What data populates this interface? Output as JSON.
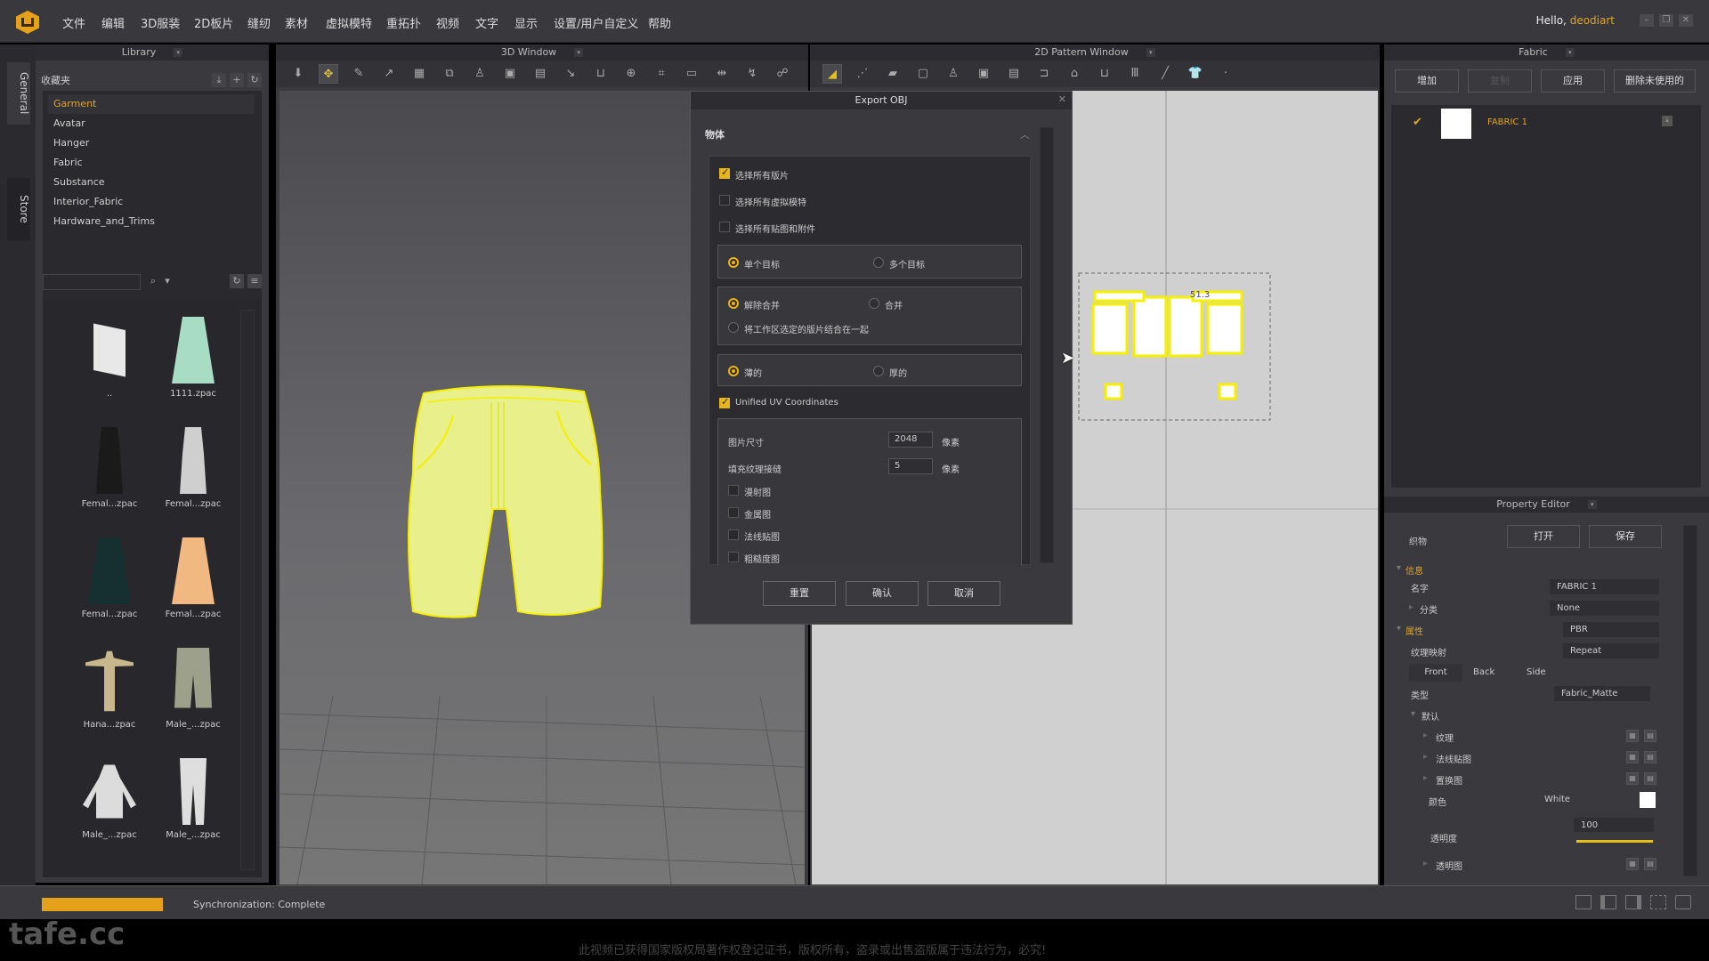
{
  "app": {
    "menu": [
      "文件",
      "编辑",
      "3D服装",
      "2D板片",
      "缝纫",
      "素材",
      "虚拟模特",
      "重拓扑",
      "视频",
      "文字",
      "显示",
      "设置/用户自定义",
      "帮助"
    ],
    "greeting": "Hello,",
    "username": "deodiart",
    "window_controls": {
      "minimize": "–",
      "restore": "❐",
      "close": "✕"
    }
  },
  "side_tabs": [
    "General",
    "Store"
  ],
  "library": {
    "title": "Library",
    "favorites_label": "收藏夹",
    "tree": [
      "Garment",
      "Avatar",
      "Hanger",
      "Fabric",
      "Substance",
      "Interior_Fabric",
      "Hardware_and_Trims"
    ],
    "selected": "Garment",
    "search_placeholder": "",
    "items": [
      {
        "label": "..",
        "color": "#e8e8e8",
        "shape": "folder"
      },
      {
        "label": "1111.zpac",
        "color": "#a8dcc4",
        "shape": "skirt"
      },
      {
        "label": "Femal...zpac",
        "color": "#1a1a1a",
        "shape": "dress"
      },
      {
        "label": "Femal...zpac",
        "color": "#cfcfcf",
        "shape": "dress"
      },
      {
        "label": "Femal...zpac",
        "color": "#163032",
        "shape": "skirt"
      },
      {
        "label": "Femal...zpac",
        "color": "#f2b882",
        "shape": "skirt"
      },
      {
        "label": "Hana...zpac",
        "color": "#c8b68c",
        "shape": "avatar"
      },
      {
        "label": "Male_...zpac",
        "color": "#9da08a",
        "shape": "shorts"
      },
      {
        "label": "Male_...zpac",
        "color": "#dcdcdc",
        "shape": "hoodie"
      },
      {
        "label": "Male_...zpac",
        "color": "#dedede",
        "shape": "pants"
      }
    ]
  },
  "window3d": {
    "title": "3D Window"
  },
  "window2d": {
    "title": "2D Pattern Window",
    "measurement": "51.3"
  },
  "dialog": {
    "title": "Export OBJ",
    "section": "物体",
    "select_all_patterns": {
      "label": "选择所有版片",
      "checked": true
    },
    "select_all_avatars": {
      "label": "选择所有虚拟模特",
      "checked": false
    },
    "select_all_trims": {
      "label": "选择所有贴图和附件",
      "checked": false
    },
    "object_mode": {
      "options": [
        "单个目标",
        "多个目标"
      ],
      "selected": "单个目标"
    },
    "merge_mode": {
      "options": [
        "解除合并",
        "合并",
        "将工作区选定的版片结合在一起"
      ],
      "selected": "解除合并"
    },
    "thickness": {
      "options": [
        "薄的",
        "厚的"
      ],
      "selected": "薄的"
    },
    "unified_uv": {
      "label": "Unified UV Coordinates",
      "checked": true
    },
    "image_size": {
      "label": "图片尺寸",
      "value": "2048",
      "unit": "像素"
    },
    "padding": {
      "label": "填充纹理接缝",
      "value": "5",
      "unit": "像素"
    },
    "maps": [
      {
        "label": "漫射图",
        "checked": false
      },
      {
        "label": "金属图",
        "checked": false
      },
      {
        "label": "法线贴图",
        "checked": false
      },
      {
        "label": "粗糙度图",
        "checked": false
      }
    ],
    "buttons": {
      "reset": "重置",
      "confirm": "确认",
      "cancel": "取消"
    }
  },
  "fabric_panel": {
    "title": "Fabric",
    "buttons": [
      "增加",
      "复制",
      "应用",
      "删除未使用的"
    ],
    "items": [
      {
        "name": "FABRIC 1",
        "checked": true,
        "swatch": "#ffffff"
      }
    ]
  },
  "property_editor": {
    "title": "Property Editor",
    "fabric_label": "织物",
    "open": "打开",
    "save": "保存",
    "info_section": "信息",
    "name_label": "名字",
    "name_value": "FABRIC 1",
    "category_label": "分类",
    "category_value": "None",
    "property_section": "属性",
    "property_value": "PBR",
    "texture_mapping_label": "纹理映射",
    "texture_mapping_value": "Repeat",
    "sides": [
      "Front",
      "Back",
      "Side"
    ],
    "type_label": "类型",
    "type_value": "Fabric_Matte",
    "default_section": "默认",
    "texture_label": "纹理",
    "normal_label": "法线贴图",
    "displacement_label": "置换图",
    "color_label": "颜色",
    "color_value": "White",
    "opacity_label": "透明度",
    "opacity_value": "100",
    "opacity_percent": 100,
    "opacity_map_label": "透明图"
  },
  "status": {
    "progress_percent": 100,
    "text": "Synchronization: Complete"
  },
  "overlay": {
    "watermark": "tafe.cc",
    "copyright": "此视频已获得国家版权局著作权登记证书，版权所有，盗录或出售盗版属于违法行为，必究!"
  },
  "colors": {
    "accent": "#e6a11b",
    "highlight_text": "#e0a52a",
    "garment": "#e9ef8a"
  }
}
